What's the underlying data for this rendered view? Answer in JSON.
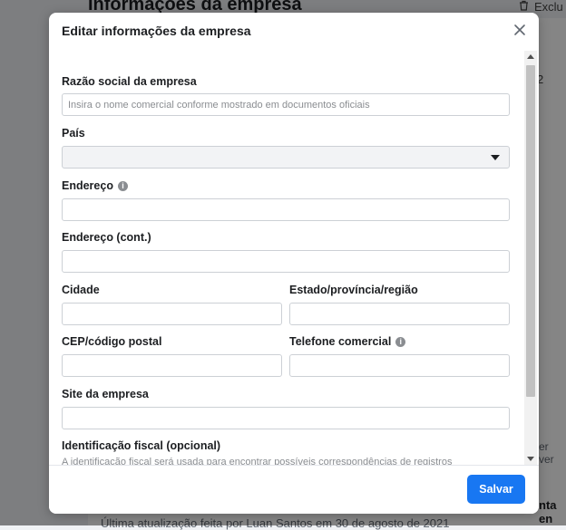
{
  "background": {
    "page_title": "Informações da empresa",
    "delete_label": "Exclu",
    "side_number": "2",
    "side_text_1": "er ver",
    "side_text_2": "nta en",
    "last_updated": "Última atualização feita por Luan Santos em 30 de agosto de 2021"
  },
  "modal": {
    "title": "Editar informações da empresa",
    "fields": {
      "legal_name": {
        "label": "Razão social da empresa",
        "placeholder": "Insira o nome comercial conforme mostrado em documentos oficiais",
        "value": ""
      },
      "country": {
        "label": "País",
        "value": ""
      },
      "address": {
        "label": "Endereço",
        "value": ""
      },
      "address2": {
        "label": "Endereço (cont.)",
        "value": ""
      },
      "city": {
        "label": "Cidade",
        "value": ""
      },
      "state": {
        "label": "Estado/província/região",
        "value": ""
      },
      "postal": {
        "label": "CEP/código postal",
        "value": ""
      },
      "phone": {
        "label": "Telefone comercial",
        "value": ""
      },
      "website": {
        "label": "Site da empresa",
        "value": ""
      },
      "tax_id": {
        "label": "Identificação fiscal (opcional)",
        "help": "A identificação fiscal será usada para encontrar possíveis correspondências de registros"
      }
    },
    "save_label": "Salvar"
  },
  "icons": {
    "close": "close-icon",
    "info": "info-icon",
    "dropdown": "chevron-down-icon",
    "delete": "trash-icon"
  },
  "colors": {
    "primary": "#1877f2",
    "overlay": "#7a7a7a"
  }
}
